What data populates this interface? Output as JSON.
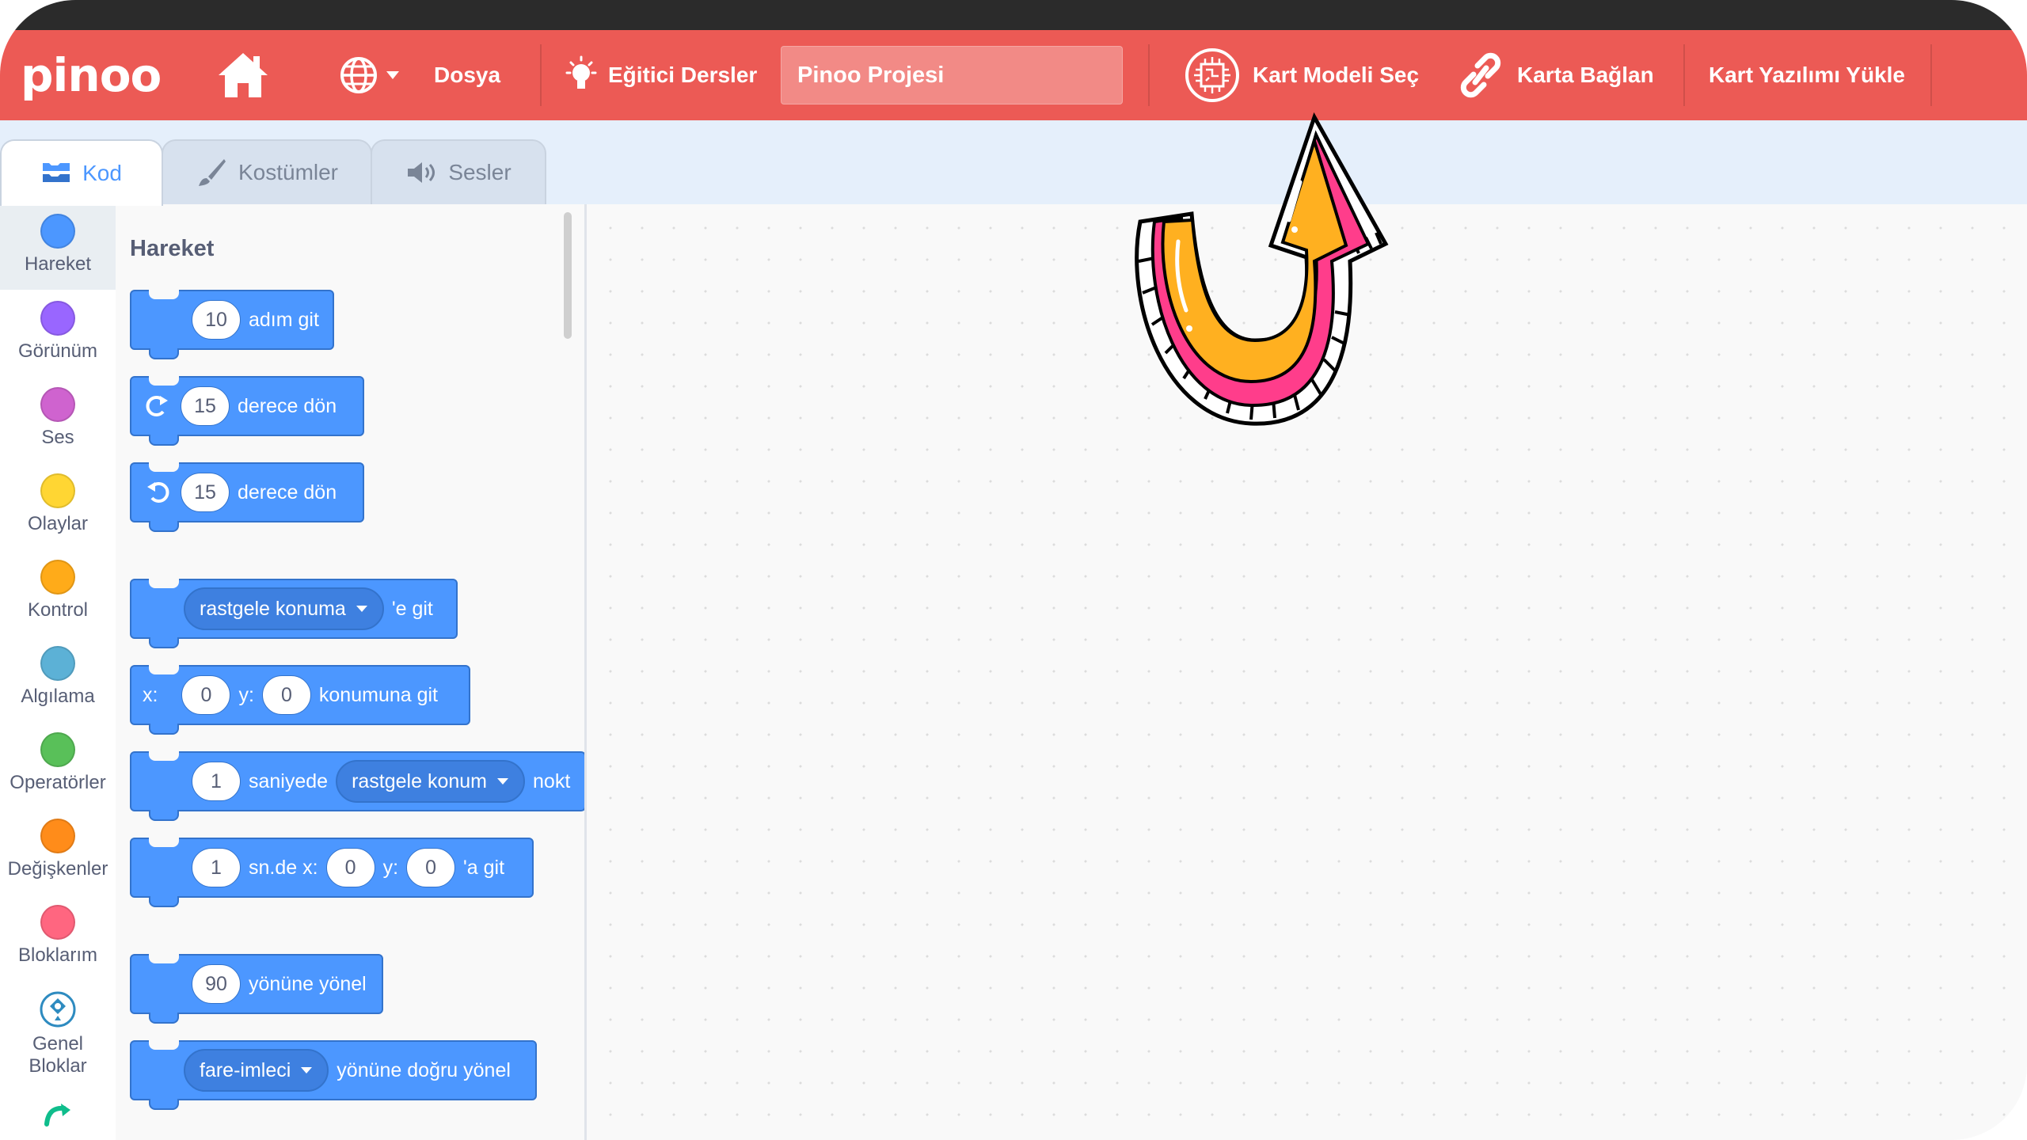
{
  "menubar": {
    "logo": "pinoo",
    "file_label": "Dosya",
    "tutorials_label": "Eğitici Dersler",
    "project_title": "Pinoo Projesi",
    "board_model_label": "Kart Modeli Seç",
    "connect_label": "Karta Bağlan",
    "upload_firmware_label": "Kart Yazılımı Yükle"
  },
  "tabs": {
    "code": "Kod",
    "costumes": "Kostümler",
    "sounds": "Sesler"
  },
  "categories": [
    {
      "label": "Hareket",
      "color": "#4c97ff"
    },
    {
      "label": "Görünüm",
      "color": "#9966ff"
    },
    {
      "label": "Ses",
      "color": "#cf63cf"
    },
    {
      "label": "Olaylar",
      "color": "#ffd633"
    },
    {
      "label": "Kontrol",
      "color": "#ffab19"
    },
    {
      "label": "Algılama",
      "color": "#5cb1d6"
    },
    {
      "label": "Operatörler",
      "color": "#59c059"
    },
    {
      "label": "Değişkenler",
      "color": "#ff8c1a"
    },
    {
      "label": "Bloklarım",
      "color": "#ff6680"
    },
    {
      "label": "Genel Bloklar",
      "color": "#0fbd8c"
    }
  ],
  "palette": {
    "title": "Hareket",
    "blocks": {
      "move": {
        "value": "10",
        "text": "adım git"
      },
      "turn_right": {
        "value": "15",
        "text": "derece dön"
      },
      "turn_left": {
        "value": "15",
        "text": "derece dön"
      },
      "goto": {
        "dropdown": "rastgele konuma",
        "text": "'e git"
      },
      "goto_xy": {
        "x_label": "x:",
        "x": "0",
        "y_label": "y:",
        "y": "0",
        "text": "konumuna git"
      },
      "glide": {
        "value": "1",
        "text1": "saniyede",
        "dropdown": "rastgele konum",
        "text2": "nokt"
      },
      "glide_xy": {
        "value": "1",
        "text1": "sn.de x:",
        "x": "0",
        "y_label": "y:",
        "y": "0",
        "text2": "'a git"
      },
      "point_dir": {
        "value": "90",
        "text": "yönüne yönel"
      },
      "point_towards": {
        "dropdown": "fare-imleci",
        "text": "yönüne doğru yönel"
      }
    }
  },
  "colors": {
    "menubar": "#ec5a55",
    "motion": "#4c97ff",
    "arrow_orange": "#ffb020",
    "arrow_pink": "#ff3d8b"
  }
}
